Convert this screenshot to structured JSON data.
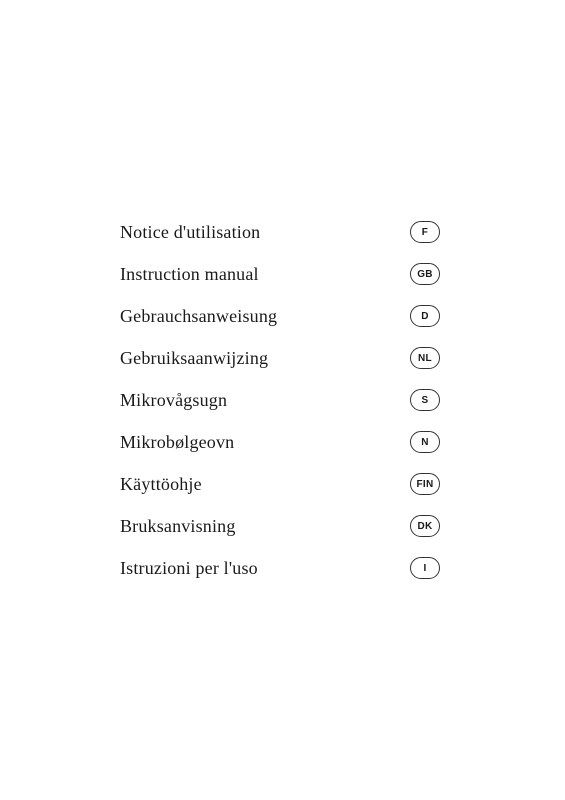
{
  "page": {
    "background": "#ffffff"
  },
  "items": [
    {
      "label": "Notice d'utilisation",
      "badge": "F"
    },
    {
      "label": "Instruction manual",
      "badge": "GB"
    },
    {
      "label": "Gebrauchsanweisung",
      "badge": "D"
    },
    {
      "label": "Gebruiksaanwijzing",
      "badge": "NL"
    },
    {
      "label": "Mikrovågsugn",
      "badge": "S"
    },
    {
      "label": "Mikrobølgeovn",
      "badge": "N"
    },
    {
      "label": "Käyttöohje",
      "badge": "FIN"
    },
    {
      "label": "Bruksanvisning",
      "badge": "DK"
    },
    {
      "label": "Istruzioni per l'uso",
      "badge": "I"
    }
  ]
}
